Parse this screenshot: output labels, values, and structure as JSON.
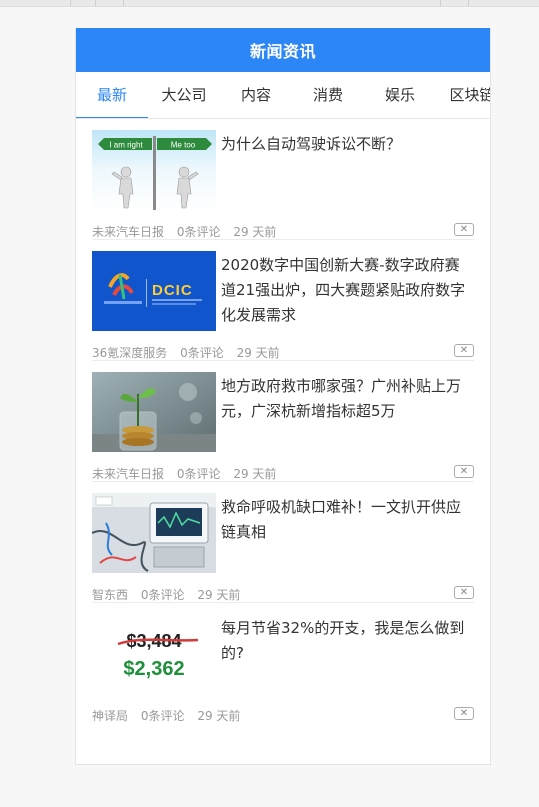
{
  "header": {
    "title": "新闻资讯"
  },
  "tabs": [
    {
      "label": "最新",
      "active": true
    },
    {
      "label": "大公司",
      "active": false
    },
    {
      "label": "内容",
      "active": false
    },
    {
      "label": "消费",
      "active": false
    },
    {
      "label": "娱乐",
      "active": false
    },
    {
      "label": "区块链",
      "active": false
    }
  ],
  "news": [
    {
      "title": "为什么自动驾驶诉讼不断？",
      "source": "未来汽车日报",
      "comments": "0条评论",
      "time": "29 天前",
      "thumb": {
        "sign_left": "I am right",
        "sign_right": "Me too"
      }
    },
    {
      "title": "2020数字中国创新大赛-数字政府赛道21强出炉，四大赛题紧贴政府数字化发展需求",
      "source": "36氪深度服务",
      "comments": "0条评论",
      "time": "29 天前",
      "thumb": {
        "logo": "DCIC"
      }
    },
    {
      "title": "地方政府救市哪家强？广州补贴上万元，广深杭新增指标超5万",
      "source": "未来汽车日报",
      "comments": "0条评论",
      "time": "29 天前"
    },
    {
      "title": "救命呼吸机缺口难补！一文扒开供应链真相",
      "source": "智东西",
      "comments": "0条评论",
      "time": "29 天前"
    },
    {
      "title": "每月节省32%的开支，我是怎么做到的?",
      "source": "神译局",
      "comments": "0条评论",
      "time": "29 天前",
      "thumb": {
        "old_price": "$3,484",
        "new_price": "$2,362"
      }
    }
  ],
  "close_glyph": "✕",
  "colors": {
    "accent": "#2d86f5",
    "meta": "#999999"
  }
}
